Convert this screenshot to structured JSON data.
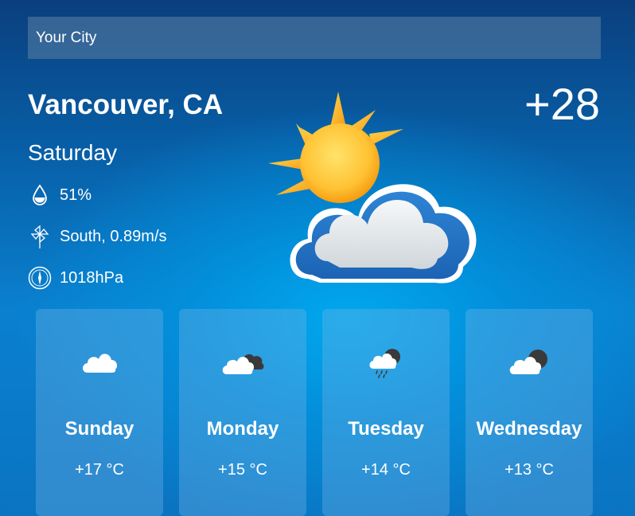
{
  "search": {
    "placeholder": "Your City"
  },
  "current": {
    "city": "Vancouver, CA",
    "day": "Saturday",
    "temperature": "+28",
    "humidity": "51%",
    "wind": "South, 0.89m/s",
    "pressure": "1018hPa",
    "condition_icon": "sun-behind-cloud-icon"
  },
  "forecast": [
    {
      "day": "Sunday",
      "temp": "+17 °C",
      "icon": "cloud-icon"
    },
    {
      "day": "Monday",
      "temp": "+15 °C",
      "icon": "broken-clouds-icon"
    },
    {
      "day": "Tuesday",
      "temp": "+14 °C",
      "icon": "rain-cloud-icon"
    },
    {
      "day": "Wednesday",
      "temp": "+13 °C",
      "icon": "broken-clouds-icon"
    }
  ],
  "colors": {
    "background_top": "#0a3f7e",
    "background_center": "#00aaf0",
    "text": "#ffffff"
  }
}
